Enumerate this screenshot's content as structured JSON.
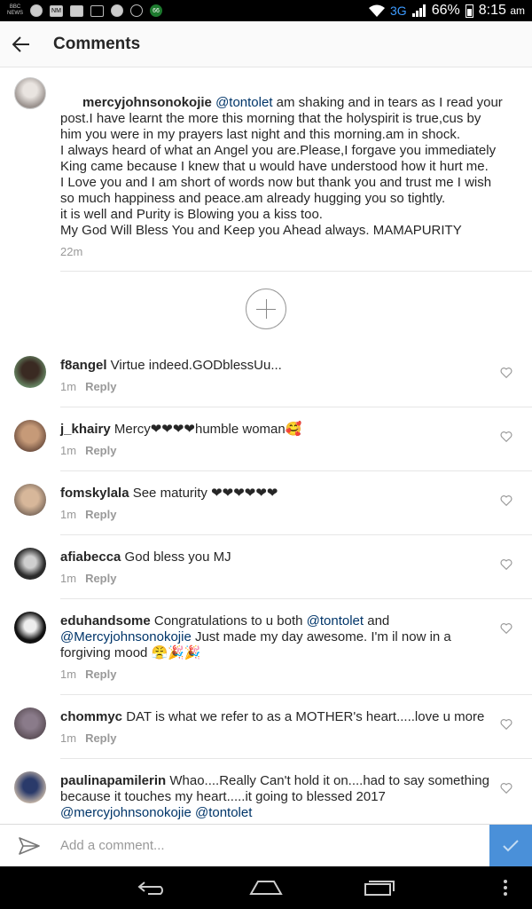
{
  "status_bar": {
    "network": "3G",
    "battery": "66%",
    "time": "8:15",
    "ampm": "am",
    "left_icons": [
      "bbc-news-icon",
      "messenger-icon",
      "nm-app-icon",
      "mail-icon",
      "gallery-icon",
      "spotify-icon",
      "chat-icon",
      "badge-66-icon"
    ],
    "left_icon_labels": [
      "BBC NEWS",
      "",
      "NM",
      "",
      "",
      "",
      "",
      "66"
    ]
  },
  "header": {
    "title": "Comments"
  },
  "main_post": {
    "username": "mercyjohnsonokojie",
    "mention": "@tontolet",
    "text": " am shaking and in tears as I read your post.I have learnt the more this morning that the holyspirit is true,cus by him you were in my prayers last night and this morning.am in shock.\nI always heard of what an Angel you are.Please,I forgave you immediately King came because I knew that u would have understood how it hurt me.\nI Love you and I am short of words now but thank you and trust me I wish so much happiness and peace.am already hugging you so tightly.\nit is well and Purity is Blowing you a kiss too.\nMy God Will Bless You and Keep you Ahead always. MAMAPURITY",
    "time": "22m"
  },
  "comments": [
    {
      "username": "f8angel",
      "pre": " Virtue indeed.GODblessUu...",
      "mention1": "",
      "mid": "",
      "mention2": "",
      "post": "",
      "time": "1m",
      "reply": "Reply"
    },
    {
      "username": "j_khairy",
      "pre": " Mercy❤❤❤❤humble woman🥰",
      "mention1": "",
      "mid": "",
      "mention2": "",
      "post": "",
      "time": "1m",
      "reply": "Reply"
    },
    {
      "username": "fomskylala",
      "pre": " See maturity ❤❤❤❤❤❤",
      "mention1": "",
      "mid": "",
      "mention2": "",
      "post": "",
      "time": "1m",
      "reply": "Reply"
    },
    {
      "username": "afiabecca",
      "pre": " God bless you MJ",
      "mention1": "",
      "mid": "",
      "mention2": "",
      "post": "",
      "time": "1m",
      "reply": "Reply"
    },
    {
      "username": "eduhandsome",
      "pre": " Congratulations to u both ",
      "mention1": "@tontolet",
      "mid": " and ",
      "mention2": "@Mercyjohnsonokojie",
      "post": "  Just made my day awesome. I'm il now in a forgiving mood 😤🎉🎉",
      "time": "1m",
      "reply": "Reply"
    },
    {
      "username": "chommyc",
      "pre": " DAT is what we refer to as a MOTHER's heart.....love u more",
      "mention1": "",
      "mid": "",
      "mention2": "",
      "post": "",
      "time": "1m",
      "reply": "Reply"
    },
    {
      "username": "paulinapamilerin",
      "pre": " Whao....Really Can't hold it on....had to say something because it touches my heart.....it going to blessed 2017 ",
      "mention1": "@mercyjohnsonokojie",
      "mid": " ",
      "mention2": "@tontolet",
      "post": "",
      "time": "",
      "reply": ""
    }
  ],
  "comment_input": {
    "placeholder": "Add a comment..."
  },
  "colors": {
    "mention": "#003569",
    "post_button": "#4a90d9",
    "heart_stroke": "#999999"
  }
}
